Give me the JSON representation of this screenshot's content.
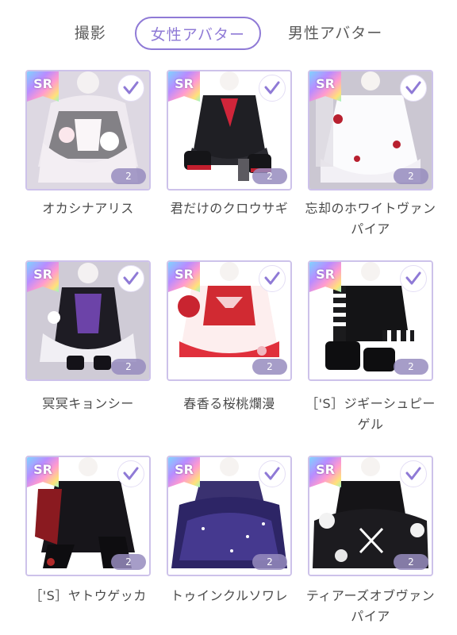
{
  "tabs": [
    {
      "label": "撮影",
      "active": false
    },
    {
      "label": "女性アバター",
      "active": true
    },
    {
      "label": "男性アバター",
      "active": false
    }
  ],
  "badge_label": "SR",
  "accent_color": "#8f7ad6",
  "items": [
    {
      "name": "オカシナアリス",
      "count": "2",
      "owned": true
    },
    {
      "name": "君だけのクロウサギ",
      "count": "2",
      "owned": true
    },
    {
      "name": "忘却のホワイトヴァンパイア",
      "count": "2",
      "owned": true
    },
    {
      "name": "冥冥キョンシー",
      "count": "2",
      "owned": true
    },
    {
      "name": "春香る桜桃爛漫",
      "count": "2",
      "owned": true
    },
    {
      "name": "［'S］ジギーシュピーゲル",
      "count": "2",
      "owned": true
    },
    {
      "name": "［'S］ヤトウゲッカ",
      "count": "2",
      "owned": true
    },
    {
      "name": "トゥインクルソワレ",
      "count": "2",
      "owned": true
    },
    {
      "name": "ティアーズオブヴァンパイア",
      "count": "2",
      "owned": true
    }
  ]
}
